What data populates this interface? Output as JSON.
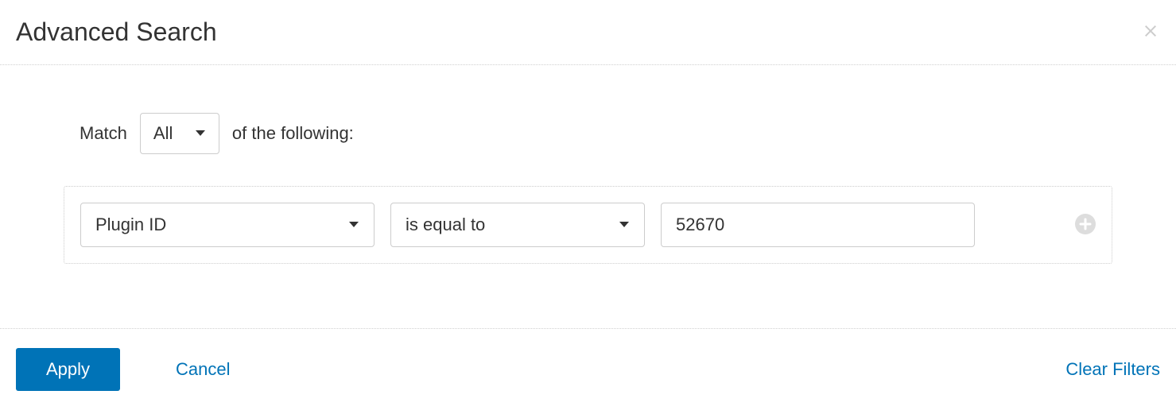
{
  "header": {
    "title": "Advanced Search"
  },
  "body": {
    "match_label_before": "Match",
    "match_value": "All",
    "match_label_after": "of the following:",
    "filter": {
      "field": "Plugin ID",
      "operator": "is equal to",
      "value": "52670"
    }
  },
  "footer": {
    "apply_label": "Apply",
    "cancel_label": "Cancel",
    "clear_label": "Clear Filters"
  }
}
